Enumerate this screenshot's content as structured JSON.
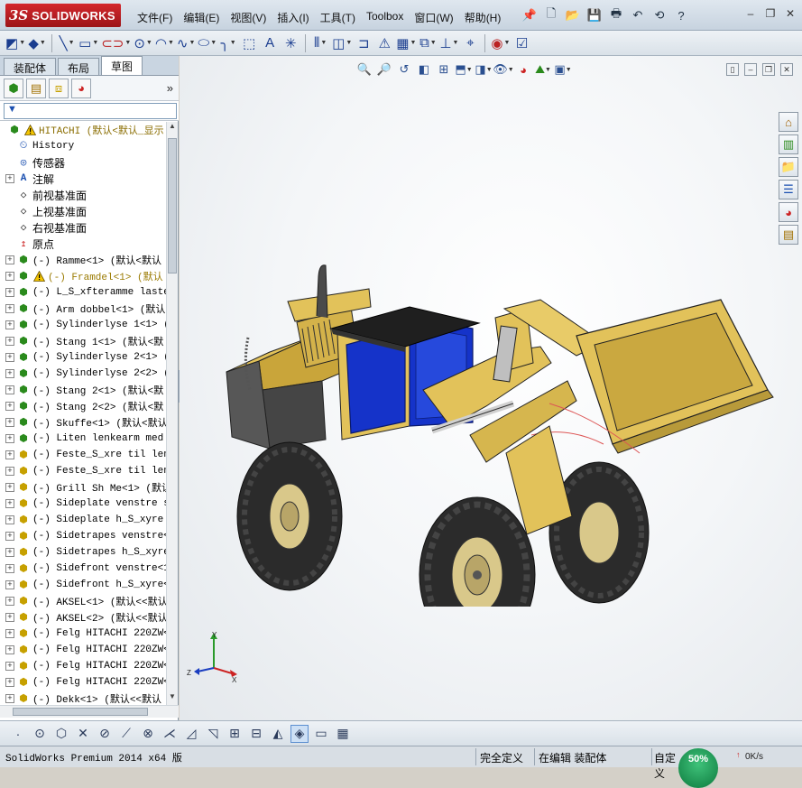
{
  "app": {
    "logo_ds": "3S",
    "logo_text": "SOLIDWORKS"
  },
  "menu": [
    {
      "label": "文件(F)"
    },
    {
      "label": "编辑(E)"
    },
    {
      "label": "视图(V)"
    },
    {
      "label": "插入(I)"
    },
    {
      "label": "工具(T)"
    },
    {
      "label": "Toolbox"
    },
    {
      "label": "窗口(W)"
    },
    {
      "label": "帮助(H)"
    }
  ],
  "top_icons": [
    "pin-icon",
    "new-document-icon",
    "open-icon",
    "save-icon",
    "print-icon",
    "undo-icon",
    "rebuild-icon",
    "help-icon"
  ],
  "window_buttons": {
    "minimize": "–",
    "restore": "❐",
    "close": "✕"
  },
  "sketch_toolbar": [
    "smart-dimension-icon",
    "sketch-entity-icon",
    "line-icon",
    "rectangle-icon",
    "slot-icon",
    "circle-icon",
    "arc-icon",
    "spline-icon",
    "ellipse-icon",
    "fillet-icon",
    "point-icon",
    "text-icon",
    "centerline-icon",
    "mirror-icon",
    "offset-icon",
    "convert-icon",
    "trim-icon",
    "pattern-icon",
    "move-icon",
    "relations-icon",
    "repair-icon",
    "quick-snaps-icon",
    "instant2d-icon",
    "shaded-sketch-icon"
  ],
  "manager_tabs": [
    {
      "label": "装配体",
      "active": false
    },
    {
      "label": "布局",
      "active": false
    },
    {
      "label": "草图",
      "active": true
    }
  ],
  "manager_toolbar": [
    "featuremanager-icon",
    "propertymanager-icon",
    "configurationmanager-icon",
    "displaymanager-icon"
  ],
  "expand_chevron": "»",
  "tree": {
    "root": {
      "label": "HITACHI  (默认<默认_显示"
    },
    "items": [
      {
        "label": "History",
        "icon": "history-icon",
        "expandable": false,
        "cn": false,
        "warn": false
      },
      {
        "label": "传感器",
        "icon": "sensor-icon",
        "expandable": false,
        "cn": true,
        "warn": false
      },
      {
        "label": "注解",
        "icon": "annotation-icon",
        "expandable": true,
        "cn": true,
        "warn": false
      },
      {
        "label": "前视基准面",
        "icon": "plane-icon",
        "expandable": false,
        "cn": true,
        "warn": false
      },
      {
        "label": "上视基准面",
        "icon": "plane-icon",
        "expandable": false,
        "cn": true,
        "warn": false
      },
      {
        "label": "右视基准面",
        "icon": "plane-icon",
        "expandable": false,
        "cn": true,
        "warn": false
      },
      {
        "label": "原点",
        "icon": "origin-icon",
        "expandable": false,
        "cn": true,
        "warn": false
      },
      {
        "label": "(-) Ramme<1> (默认<默认",
        "icon": "subassembly-icon",
        "expandable": true,
        "cn": false,
        "warn": false
      },
      {
        "label": "(-) Framdel<1> (默认",
        "icon": "subassembly-icon",
        "expandable": true,
        "cn": false,
        "warn": true
      },
      {
        "label": "(-) L_S_xfteramme laste",
        "icon": "subassembly-icon",
        "expandable": true,
        "cn": false,
        "warn": false
      },
      {
        "label": "(-) Arm dobbel<1> (默认",
        "icon": "subassembly-icon",
        "expandable": true,
        "cn": false,
        "warn": false
      },
      {
        "label": "(-) Sylinderlyse 1<1> (",
        "icon": "subassembly-icon",
        "expandable": true,
        "cn": false,
        "warn": false
      },
      {
        "label": "(-) Stang 1<1> (默认<默",
        "icon": "subassembly-icon",
        "expandable": true,
        "cn": false,
        "warn": false
      },
      {
        "label": "(-) Sylinderlyse 2<1> (",
        "icon": "subassembly-icon",
        "expandable": true,
        "cn": false,
        "warn": false
      },
      {
        "label": "(-) Sylinderlyse 2<2> (",
        "icon": "subassembly-icon",
        "expandable": true,
        "cn": false,
        "warn": false
      },
      {
        "label": "(-) Stang 2<1> (默认<默",
        "icon": "subassembly-icon",
        "expandable": true,
        "cn": false,
        "warn": false
      },
      {
        "label": "(-) Stang 2<2> (默认<默",
        "icon": "subassembly-icon",
        "expandable": true,
        "cn": false,
        "warn": false
      },
      {
        "label": "(-) Skuffe<1> (默认<默认",
        "icon": "subassembly-icon",
        "expandable": true,
        "cn": false,
        "warn": false
      },
      {
        "label": "(-) Liten lenkearm med",
        "icon": "subassembly-icon",
        "expandable": true,
        "cn": false,
        "warn": false
      },
      {
        "label": "(-) Feste_S_xre til len",
        "icon": "part-icon",
        "expandable": true,
        "cn": false,
        "warn": false
      },
      {
        "label": "(-) Feste_S_xre til len",
        "icon": "part-icon",
        "expandable": true,
        "cn": false,
        "warn": false
      },
      {
        "label": "(-) Grill Sh Me<1> (默认",
        "icon": "part-icon",
        "expandable": true,
        "cn": false,
        "warn": false
      },
      {
        "label": "(-) Sideplate venstre s",
        "icon": "part-icon",
        "expandable": true,
        "cn": false,
        "warn": false
      },
      {
        "label": "(-) Sideplate h_S_xyre",
        "icon": "part-icon",
        "expandable": true,
        "cn": false,
        "warn": false
      },
      {
        "label": "(-) Sidetrapes venstre<",
        "icon": "part-icon",
        "expandable": true,
        "cn": false,
        "warn": false
      },
      {
        "label": "(-) Sidetrapes h_S_xyre",
        "icon": "part-icon",
        "expandable": true,
        "cn": false,
        "warn": false
      },
      {
        "label": "(-) Sidefront venstre<1",
        "icon": "part-icon",
        "expandable": true,
        "cn": false,
        "warn": false
      },
      {
        "label": "(-) Sidefront h_S_xyre<",
        "icon": "part-icon",
        "expandable": true,
        "cn": false,
        "warn": false
      },
      {
        "label": "(-) AKSEL<1> (默认<<默认",
        "icon": "part-icon",
        "expandable": true,
        "cn": false,
        "warn": false
      },
      {
        "label": "(-) AKSEL<2> (默认<<默认",
        "icon": "part-icon",
        "expandable": true,
        "cn": false,
        "warn": false
      },
      {
        "label": "(-) Felg HITACHI 220ZW<",
        "icon": "part-icon",
        "expandable": true,
        "cn": false,
        "warn": false
      },
      {
        "label": "(-) Felg HITACHI 220ZW<",
        "icon": "part-icon",
        "expandable": true,
        "cn": false,
        "warn": false
      },
      {
        "label": "(-) Felg HITACHI 220ZW<",
        "icon": "part-icon",
        "expandable": true,
        "cn": false,
        "warn": false
      },
      {
        "label": "(-) Felg HITACHI 220ZW<",
        "icon": "part-icon",
        "expandable": true,
        "cn": false,
        "warn": false
      },
      {
        "label": "(-) Dekk<1> (默认<<默认",
        "icon": "part-icon",
        "expandable": true,
        "cn": false,
        "warn": false
      }
    ]
  },
  "headsup_toolbar": [
    "zoom-to-fit-icon",
    "zoom-area-icon",
    "previous-view-icon",
    "section-view-icon",
    "dynamic-annotation-icon",
    "view-orientation-icon",
    "display-style-icon",
    "hide-show-icon",
    "edit-appearance-icon",
    "apply-scene-icon",
    "view-settings-icon"
  ],
  "task_pane": [
    "solidworks-resources-icon",
    "design-library-icon",
    "file-explorer-icon",
    "view-palette-icon",
    "appearances-icon",
    "custom-properties-icon"
  ],
  "triad": {
    "x": "X",
    "y": "Y",
    "z": "Z"
  },
  "bottom_toolbar": [
    "point-icon",
    "circle-icon",
    "polygon-icon",
    "trim-icon",
    "extend-icon",
    "split-icon",
    "construction-icon",
    "mirror-icon",
    "move-icon",
    "copy-icon",
    "grid-icon",
    "display-delete-relations-icon",
    "isometric-view-icon",
    "single-view-icon",
    "two-view-icon"
  ],
  "status": {
    "app_version": "SolidWorks Premium 2014 x64 版",
    "definition": "完全定义",
    "editing": "在编辑 装配体",
    "custom": "自定义",
    "net_percent": "50%",
    "net_speed": "0K/s"
  },
  "colors": {
    "body_yellow": "#e2c25a",
    "cab_blue": "#1533c9",
    "tire": "#2b2b2b",
    "rim": "#d9c88a",
    "logo_red": "#c0202a"
  }
}
